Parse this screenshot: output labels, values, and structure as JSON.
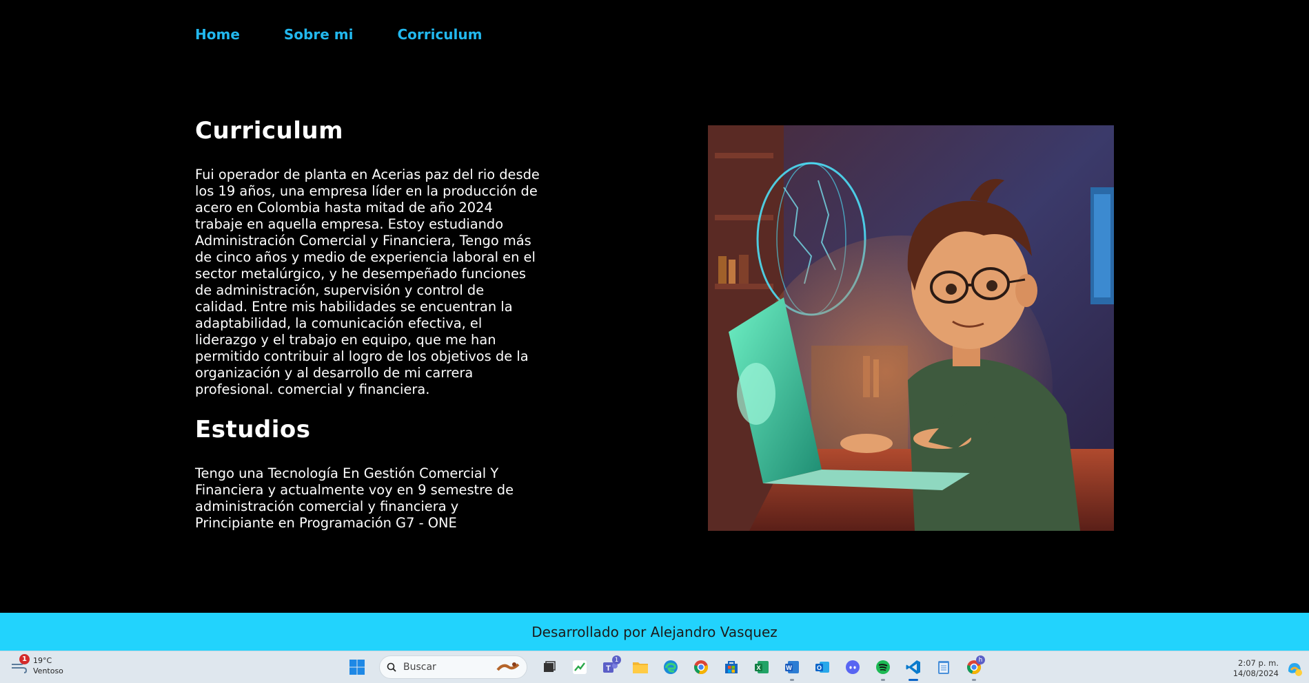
{
  "nav": {
    "items": [
      {
        "label": "Home"
      },
      {
        "label": "Sobre mi"
      },
      {
        "label": "Corriculum"
      }
    ]
  },
  "main": {
    "title": "Curriculum",
    "paragraph": "Fui operador de planta en Acerias paz del rio desde los 19 años, una empresa líder en la producción de acero en Colombia hasta mitad de año 2024 trabaje en aquella empresa. Estoy estudiando Administración Comercial y Financiera, Tengo más de cinco años y medio de experiencia laboral en el sector metalúrgico, y he desempeñado funciones de administración, supervisión y control de calidad. Entre mis habilidades se encuentran la adaptabilidad, la comunicación efectiva, el liderazgo y el trabajo en equipo, que me han permitido contribuir al logro de los objetivos de la organización y al desarrollo de mi carrera profesional. comercial y financiera.",
    "studies_title": "Estudios",
    "studies_text": "Tengo una Tecnología En Gestión Comercial Y Financiera y actualmente voy en 9 semestre de administración comercial y financiera y Principiante en Programación G7 - ONE"
  },
  "footer": {
    "text": "Desarrollado por Alejandro Vasquez"
  },
  "taskbar": {
    "weather": {
      "temp": "19°C",
      "condition": "Ventoso",
      "badge": "1"
    },
    "search_placeholder": "Buscar",
    "teams_badge": "1",
    "chrome_badge": "h",
    "time": "2:07 p. m.",
    "date": "14/08/2024",
    "apps": [
      "windows-start",
      "task-view",
      "stocks",
      "teams",
      "file-explorer",
      "edge",
      "chrome",
      "microsoft-store",
      "excel",
      "word",
      "outlook",
      "discord",
      "spotify",
      "vscode",
      "notepad",
      "chrome-profile"
    ]
  },
  "colors": {
    "accent_nav": "#22b8ee",
    "footer_band": "#22d3fd",
    "background": "#000000"
  }
}
